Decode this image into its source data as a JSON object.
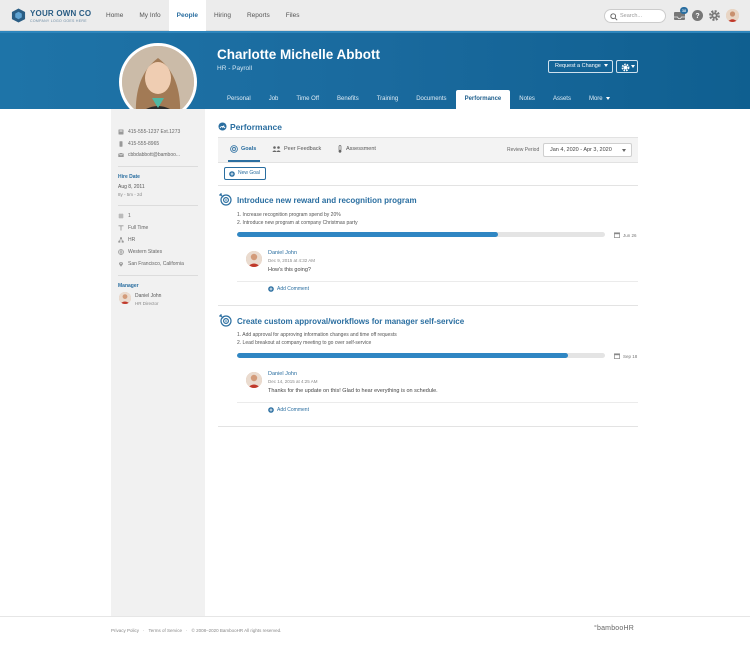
{
  "brand": {
    "name": "YOUR OWN CO",
    "tagline": "COMPANY LOGO GOES HERE",
    "color": "#2a5d84"
  },
  "nav": {
    "items": [
      "Home",
      "My Info",
      "People",
      "Hiring",
      "Reports",
      "Files"
    ],
    "active": "People"
  },
  "search": {
    "placeholder": "Search..."
  },
  "toolbar": {
    "notification_count": "38"
  },
  "profile": {
    "name": "Charlotte Michelle Abbott",
    "title": "HR - Payroll",
    "request_change_label": "Request a Change",
    "tabs": [
      "Personal",
      "Job",
      "Time Off",
      "Benefits",
      "Training",
      "Documents",
      "Performance",
      "Notes",
      "Assets",
      "More"
    ],
    "active_tab": "Performance"
  },
  "sidebar": {
    "work_phone": "415-555-1237  Ext.1273",
    "mobile_phone": "415-555-8965",
    "email": "cbbdabbott@bamboo...",
    "hire_date_label": "Hire Date",
    "hire_date": "Aug 8, 2011",
    "tenure": "8y - 5m - 2d",
    "employee_number": "1",
    "employment_status": "Full Time",
    "department": "HR",
    "division": "Western States",
    "location": "San Francisco, California",
    "manager_label": "Manager",
    "manager_name": "Daniel John",
    "manager_title": "HR Director"
  },
  "performance": {
    "title": "Performance",
    "subtabs": [
      "Goals",
      "Peer Feedback",
      "Assessment"
    ],
    "active_subtab": "Goals",
    "review_period_label": "Review Period",
    "review_period": "Jan 4, 2020 - Apr 3, 2020",
    "new_goal_label": "New Goal",
    "add_comment_label": "Add Comment",
    "goals": [
      {
        "title": "Introduce new reward and recognition program",
        "steps": [
          "1. Increase recognition program spend by 20%",
          "2. Introduce new program at company Christmas party"
        ],
        "progress": 0.71,
        "due": "Jun 26",
        "comment": {
          "author": "Daniel John",
          "date": "Dec 9, 2015 at 4:32 AM",
          "text": "How's this going?"
        }
      },
      {
        "title": "Create custom approval/workflows for manager self-service",
        "steps": [
          "1. Add approval for approving information changes and time off requests",
          "2. Lead breakout at company meeting to go over self-service"
        ],
        "progress": 0.9,
        "due": "Sep 18",
        "comment": {
          "author": "Daniel John",
          "date": "Dec 14, 2015 at 4:25 AM",
          "text": "Thanks for the update on this!  Glad to hear everything is on schedule."
        }
      }
    ]
  },
  "footer": {
    "privacy": "Privacy Policy",
    "terms": "Terms of Service",
    "copyright": "© 2008–2020 BambooHR All rights reserved.",
    "logo": "°bambooHR"
  },
  "colors": {
    "accent": "#2a6ea0",
    "banner": "#1a6a9e",
    "progress": "#2f86c3"
  }
}
